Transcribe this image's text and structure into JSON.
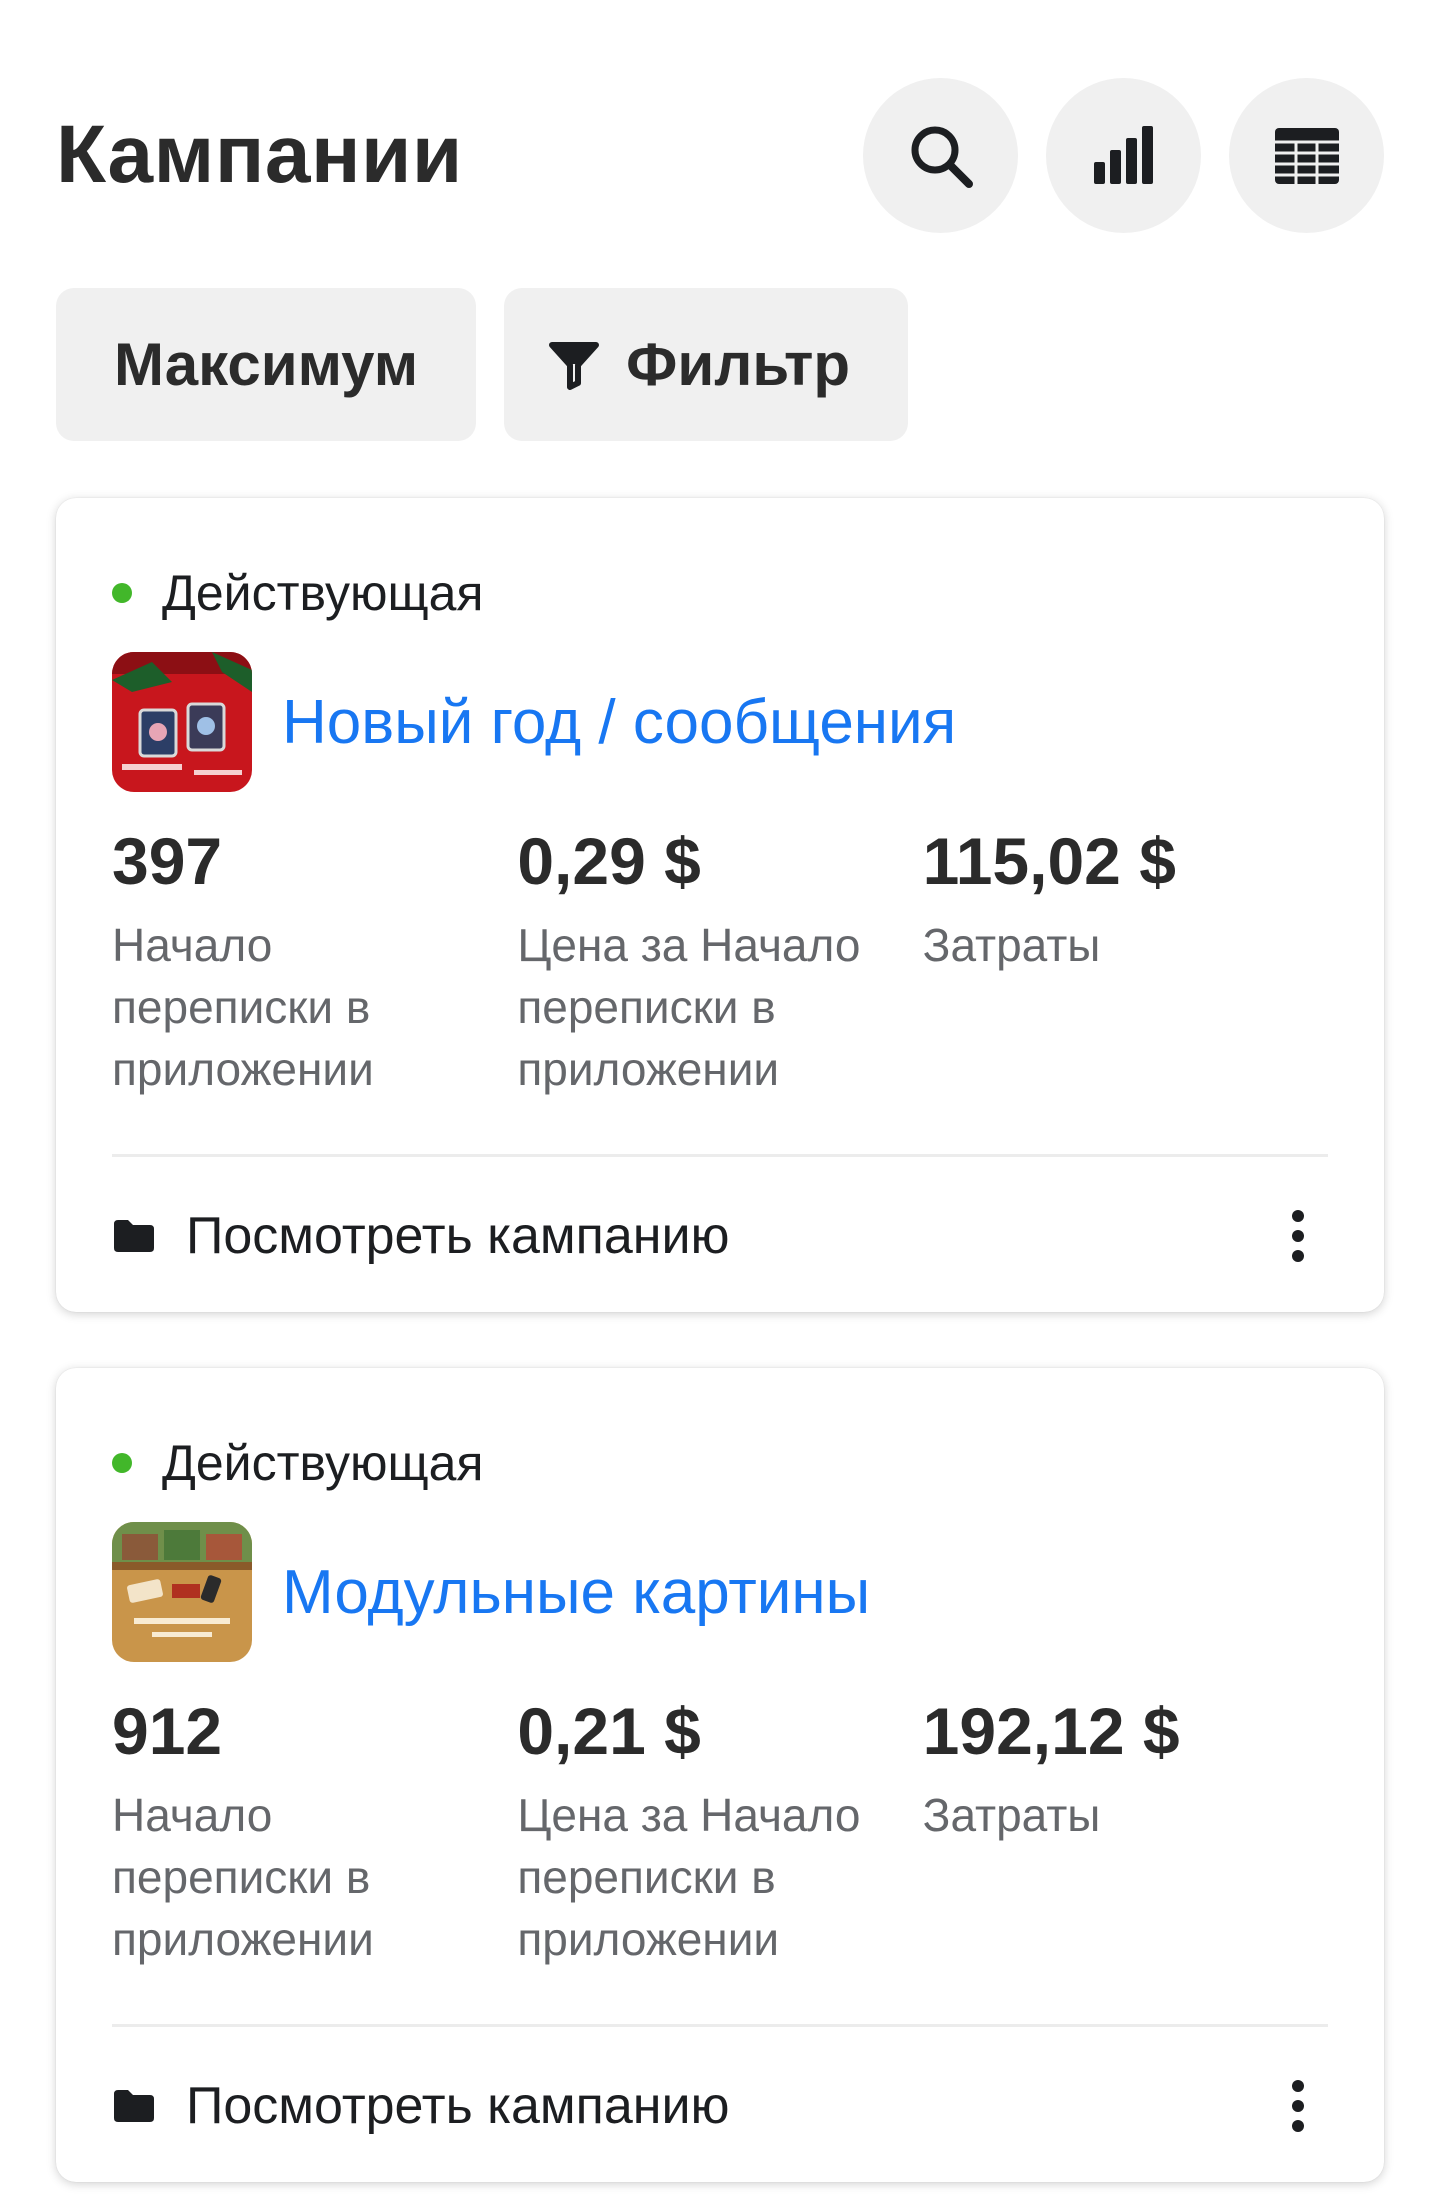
{
  "header": {
    "title": "Кампании",
    "actions": [
      "search-icon",
      "bar-chart-icon",
      "table-icon"
    ]
  },
  "filters": {
    "preset_label": "Максимум",
    "filter_label": "Фильтр"
  },
  "campaigns": [
    {
      "status": "Действующая",
      "status_color": "#42b72a",
      "name": "Новый год / сообщения",
      "metrics": [
        {
          "value": "397",
          "label": "Начало переписки в приложении"
        },
        {
          "value": "0,29 $",
          "label": "Цена за Начало переписки в приложении"
        },
        {
          "value": "115,02 $",
          "label": "Затраты"
        }
      ],
      "view_label": "Посмотреть кампанию"
    },
    {
      "status": "Действующая",
      "status_color": "#42b72a",
      "name": "Модульные картины",
      "metrics": [
        {
          "value": "912",
          "label": "Начало переписки в приложении"
        },
        {
          "value": "0,21 $",
          "label": "Цена за Начало переписки в приложении"
        },
        {
          "value": "192,12 $",
          "label": "Затраты"
        }
      ],
      "view_label": "Посмотреть кампанию"
    }
  ],
  "colors": {
    "link": "#1877f2",
    "status_active": "#42b72a",
    "button_bg": "#f0f0f0"
  }
}
